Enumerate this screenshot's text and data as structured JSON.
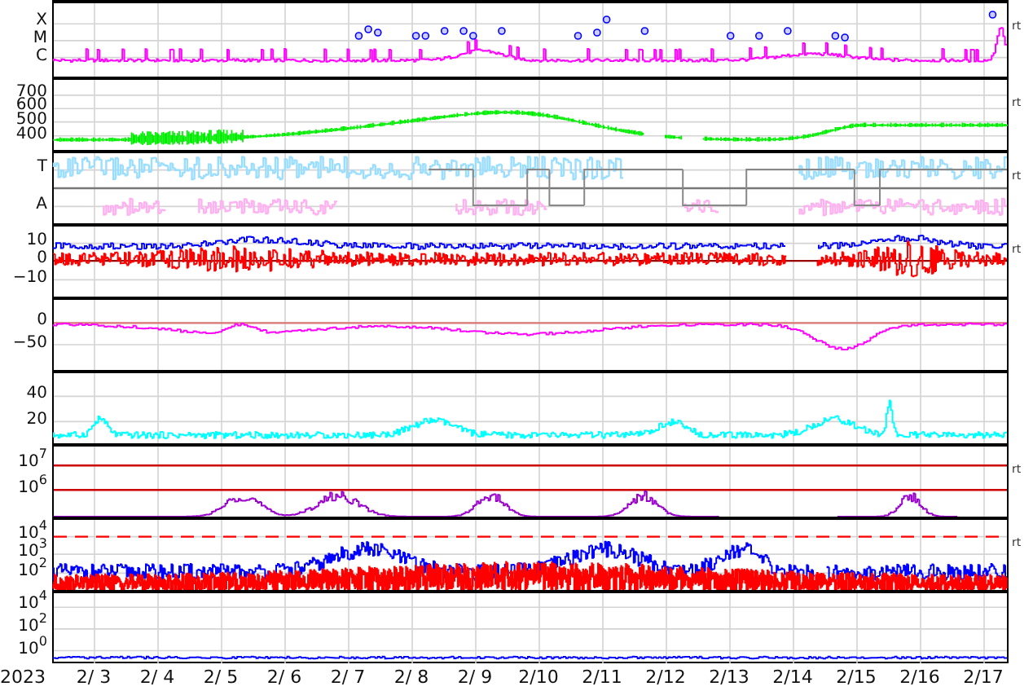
{
  "panels": [
    {
      "y_ticks": [
        "X",
        "M",
        "C"
      ],
      "side_label": "rt"
    },
    {
      "y_ticks": [
        "700",
        "600",
        "500",
        "400"
      ],
      "side_label": "rt"
    },
    {
      "y_ticks": [
        "T",
        "A"
      ],
      "side_label": "rt"
    },
    {
      "y_ticks": [
        "10",
        "0",
        "−10"
      ],
      "side_label": "rt"
    },
    {
      "y_ticks": [
        "0",
        "−50"
      ]
    },
    {
      "y_ticks": [
        "40",
        "20"
      ]
    },
    {
      "y_ticks": [
        "10$^{7}$",
        "10$^{6}$"
      ],
      "side_label": "rt"
    },
    {
      "y_ticks": [
        "10$^{4}$",
        "10$^{3}$",
        "10$^{2}$"
      ],
      "side_label": "rt"
    },
    {
      "y_ticks": [
        "10$^{4}$",
        "10$^{2}$",
        "10$^{0}$"
      ]
    }
  ],
  "x_axis": {
    "year": "2023",
    "dates": [
      "2/ 3",
      "2/ 4",
      "2/ 5",
      "2/ 6",
      "2/ 7",
      "2/ 8",
      "2/ 9",
      "2/10",
      "2/11",
      "2/12",
      "2/13",
      "2/14",
      "2/15",
      "2/16",
      "2/17"
    ]
  }
}
